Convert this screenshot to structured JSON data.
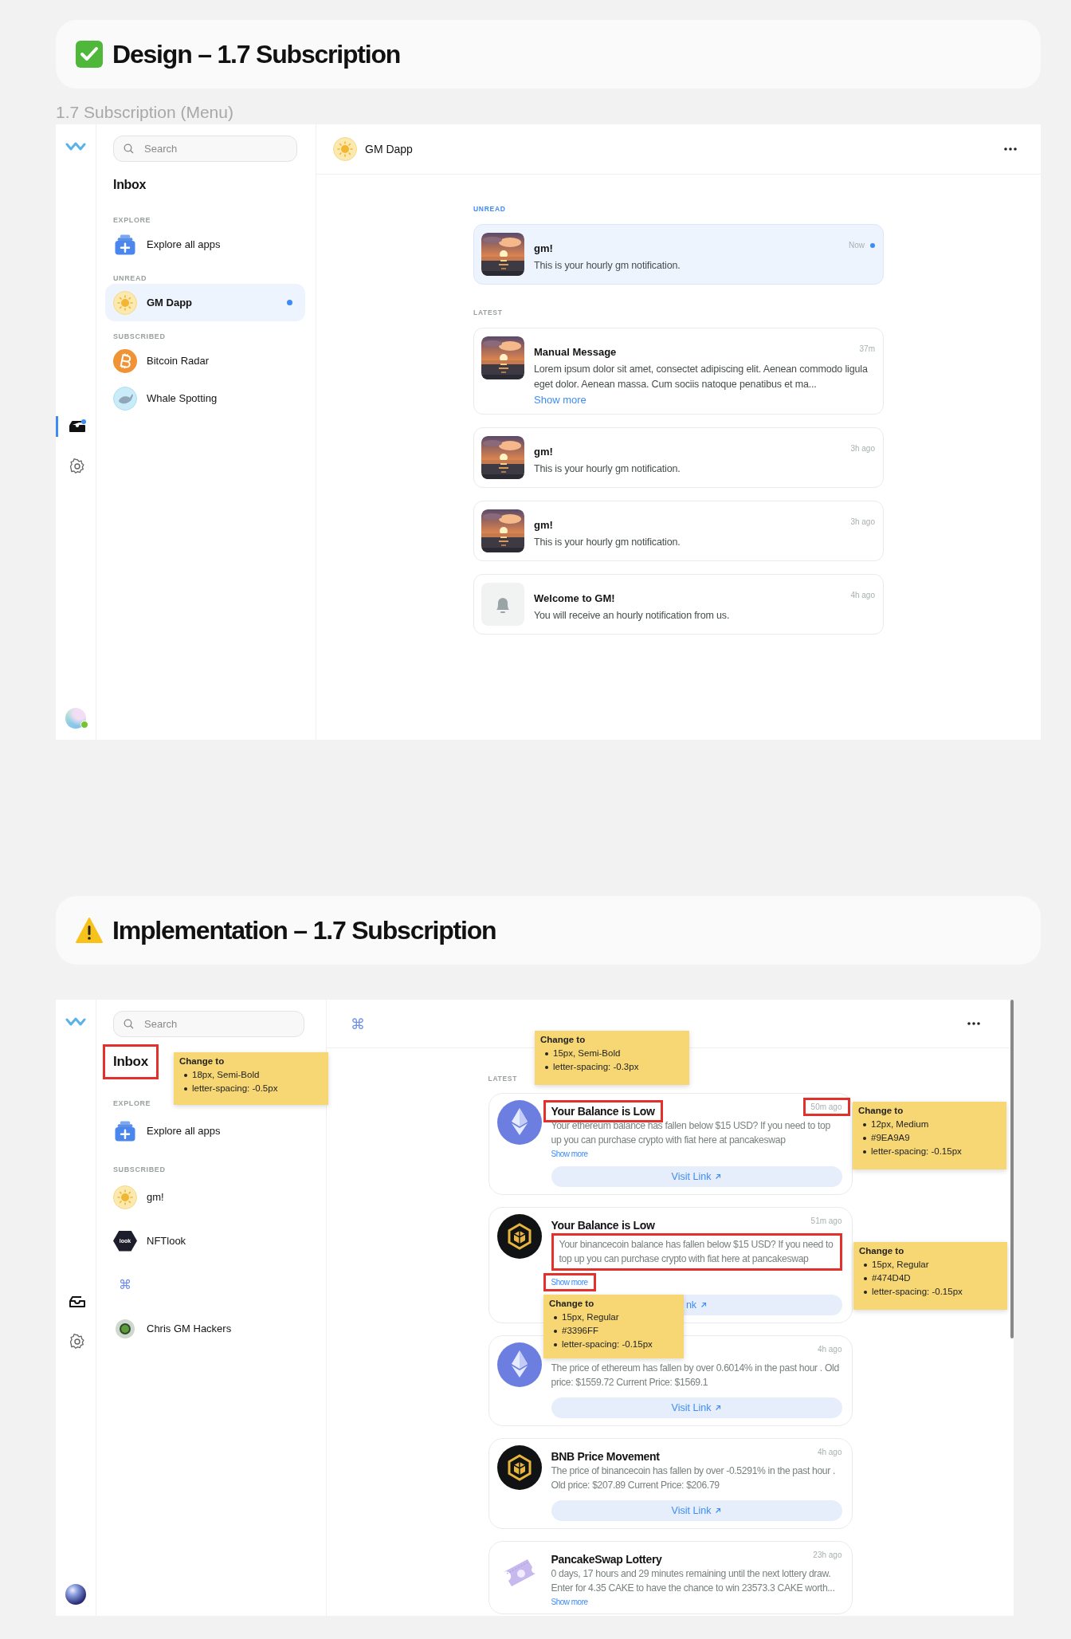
{
  "sections": [
    {
      "kind": "design",
      "title": "Design – 1.7 Subscription",
      "subtitle": "1.7 Subscription (Menu)",
      "app": {
        "rail": {
          "items": [
            {
              "kind": "inbox",
              "selected": true,
              "badge": true
            },
            {
              "kind": "settings",
              "selected": false
            }
          ],
          "avatar": {
            "kind": "gradient",
            "online": true
          }
        },
        "sidebar": {
          "search": {
            "placeholder": "Search"
          },
          "title": "Inbox",
          "title_outlined": false,
          "groups": [
            {
              "label": "EXPLORE",
              "items": [
                {
                  "kind": "apps",
                  "name": "Explore all apps",
                  "selected": false,
                  "unread": false
                }
              ]
            },
            {
              "label": "UNREAD",
              "items": [
                {
                  "kind": "sun",
                  "name": "GM Dapp",
                  "selected": true,
                  "unread": true
                }
              ]
            },
            {
              "label": "SUBSCRIBED",
              "items": [
                {
                  "kind": "bitcoin",
                  "name": "Bitcoin Radar",
                  "selected": false,
                  "unread": false
                },
                {
                  "kind": "whale",
                  "name": "Whale Spotting",
                  "selected": false,
                  "unread": false
                }
              ]
            }
          ]
        },
        "header": {
          "kind": "sun",
          "name": "GM Dapp"
        },
        "feed": {
          "groups": [
            {
              "label": "UNREAD",
              "accent": true,
              "cards": [
                {
                  "kind": "sunset",
                  "title": "gm!",
                  "time": "Now",
                  "body": "This is your hourly gm notification.",
                  "unread": true
                }
              ]
            },
            {
              "label": "LATEST",
              "accent": false,
              "cards": [
                {
                  "kind": "sunset",
                  "title": "Manual Message",
                  "time": "37m",
                  "body": "Lorem ipsum dolor sit amet, consectet adipiscing elit. Aenean commodo ligula eget dolor. Aenean massa. Cum sociis natoque penatibus et ma...",
                  "more": "Show more",
                  "unread": false
                },
                {
                  "kind": "sunset",
                  "title": "gm!",
                  "time": "3h ago",
                  "body": "This is your hourly gm notification.",
                  "unread": false
                },
                {
                  "kind": "sunset",
                  "title": "gm!",
                  "time": "3h ago",
                  "body": "This is your hourly gm notification.",
                  "unread": false
                },
                {
                  "kind": "bell",
                  "title": "Welcome to GM!",
                  "time": "4h ago",
                  "body": "You will receive an hourly notification from us.",
                  "unread": false
                }
              ]
            }
          ]
        }
      }
    },
    {
      "kind": "implementation",
      "title": "Implementation – 1.7 Subscription",
      "app": {
        "rail": {
          "items": [
            {
              "kind": "inbox",
              "selected": false,
              "badge": false
            },
            {
              "kind": "settings",
              "selected": false
            }
          ],
          "avatar": {
            "kind": "sphere"
          }
        },
        "sidebar": {
          "search": {
            "placeholder": "Search"
          },
          "title": "Inbox",
          "title_outlined": true,
          "groups": [
            {
              "label": "EXPLORE",
              "items": [
                {
                  "kind": "apps",
                  "name": "Explore all apps",
                  "selected": false,
                  "unread": false
                }
              ]
            },
            {
              "label": "SUBSCRIBED",
              "items": [
                {
                  "kind": "sun",
                  "name": "gm!",
                  "selected": false,
                  "unread": false
                },
                {
                  "kind": "badge",
                  "badge_text": "look",
                  "name": "NFTlook",
                  "selected": false,
                  "unread": false
                },
                {
                  "kind": "glyph",
                  "glyph": "⌘",
                  "selected": false,
                  "unread": false
                },
                {
                  "kind": "orb",
                  "name": "Chris GM Hackers",
                  "selected": false,
                  "unread": false
                }
              ]
            }
          ]
        },
        "header": {
          "kind": "glyph",
          "glyph": "⌘"
        },
        "feed": {
          "scrollbar": true,
          "groups": [
            {
              "label": "LATEST",
              "accent": false,
              "cards": [
                {
                  "kind": "eth",
                  "title": "Your Balance is Low",
                  "time": "50m ago",
                  "body": "Your ethereum balance has fallen below $15 USD? If you need to top up you can purchase crypto with fiat here at pancakeswap",
                  "more": "Show more",
                  "link": "Visit Link",
                  "unread": false,
                  "title_outlined": true,
                  "time_outlined": true,
                  "body_outlined": false,
                  "more_outlined": false
                },
                {
                  "kind": "bnb",
                  "title": "Your Balance is Low",
                  "time": "51m ago",
                  "body": "Your binancecoin balance has fallen below $15 USD? If you need to top up you can purchase crypto with fiat here at pancakeswap",
                  "more": "Show more",
                  "link": "nk",
                  "unread": false,
                  "title_outlined": false,
                  "time_outlined": false,
                  "body_outlined": true,
                  "more_outlined": true
                },
                {
                  "kind": "eth",
                  "time": "4h ago",
                  "body": "The price of ethereum has fallen by over 0.6014% in the past hour . Old price: $1559.72 Current Price: $1569.1",
                  "link": "Visit Link",
                  "unread": false,
                  "time_outlined": false,
                  "body_outlined": false
                },
                {
                  "kind": "bnb",
                  "title": "BNB Price Movement",
                  "time": "4h ago",
                  "body": "The price of binancecoin has fallen by over -0.5291% in the past hour . Old price: $207.89 Current Price: $206.79",
                  "link": "Visit Link",
                  "unread": false,
                  "title_outlined": false,
                  "time_outlined": false,
                  "body_outlined": false
                },
                {
                  "kind": "ticket",
                  "title": "PancakeSwap Lottery",
                  "time": "23h ago",
                  "body": "0 days, 17 hours and 29 minutes remaining until the next lottery draw. Enter for 4.35 CAKE to have the chance to win 23573.3 CAKE worth...",
                  "more": "Show more",
                  "unread": false,
                  "title_outlined": false,
                  "time_outlined": false,
                  "body_outlined": false,
                  "more_outlined": false
                }
              ]
            }
          ]
        }
      },
      "notes": [
        {
          "heading": "Change to",
          "points": [
            "18px, Semi-Bold",
            "letter-spacing: -0.5px"
          ]
        },
        {
          "heading": "Change to",
          "points": [
            "15px, Semi-Bold",
            "letter-spacing: -0.3px"
          ]
        },
        {
          "heading": "Change to",
          "points": [
            "12px, Medium",
            "#9EA9A9",
            "letter-spacing: -0.15px"
          ]
        },
        {
          "heading": "Change to",
          "points": [
            "15px, Regular",
            "#474D4D",
            "letter-spacing: -0.15px"
          ]
        },
        {
          "heading": "Change to",
          "points": [
            "15px, Regular",
            "#3396FF",
            "letter-spacing: -0.15px"
          ]
        }
      ]
    }
  ]
}
